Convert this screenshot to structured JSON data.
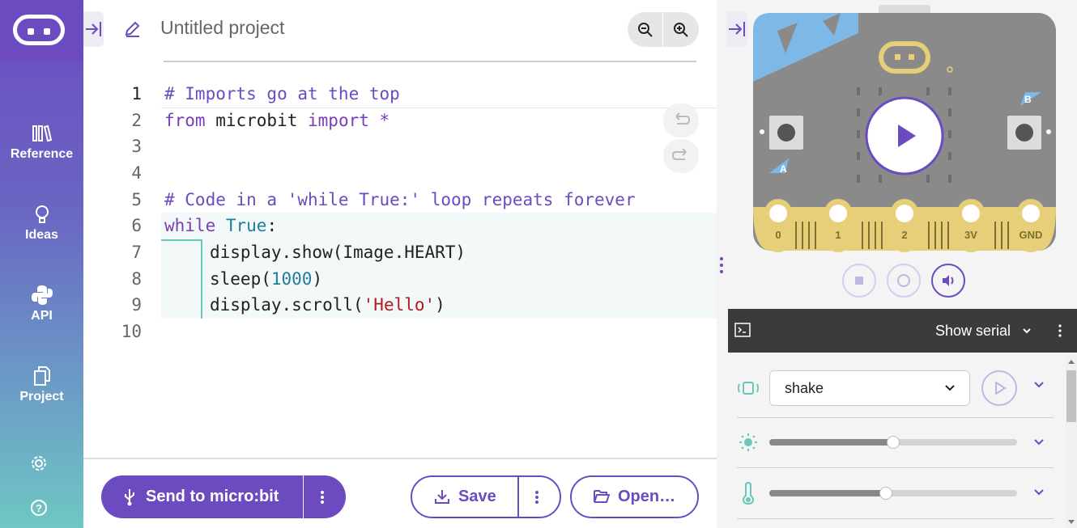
{
  "app": {
    "project_name": "Untitled project"
  },
  "sidebar": {
    "items": [
      {
        "label": "Reference",
        "icon": "books-icon"
      },
      {
        "label": "Ideas",
        "icon": "lightbulb-icon"
      },
      {
        "label": "API",
        "icon": "python-icon"
      },
      {
        "label": "Project",
        "icon": "files-icon"
      }
    ],
    "settings_icon": "gear-icon",
    "help_icon": "help-icon"
  },
  "editor": {
    "line_numbers": [
      "1",
      "2",
      "3",
      "4",
      "5",
      "6",
      "7",
      "8",
      "9",
      "10"
    ],
    "comment1": "# Imports go at the top",
    "line2_from": "from",
    "line2_mod": " microbit ",
    "line2_import": "import",
    "line2_star": " *",
    "comment2": "# Code in a 'while True:' loop repeats forever",
    "line6_while": "while",
    "line6_true": " True",
    "line6_colon": ":",
    "line7": "display.show(Image.HEART)",
    "line8_a": "sleep(",
    "line8_num": "1000",
    "line8_b": ")",
    "line9_a": "display.scroll(",
    "line9_str": "'Hello'",
    "line9_b": ")"
  },
  "toolbar": {
    "send_label": "Send to micro:bit",
    "save_label": "Save",
    "open_label": "Open…"
  },
  "simulator": {
    "pin_labels": [
      "0",
      "1",
      "2",
      "3V",
      "GND"
    ],
    "button_a": "A",
    "button_b": "B",
    "serial_label": "Show serial",
    "gesture_value": "shake",
    "light_level": 0.5,
    "temperature_level": 0.47
  },
  "colors": {
    "brand": "#6c4bc1",
    "teal": "#6ac7bb"
  }
}
